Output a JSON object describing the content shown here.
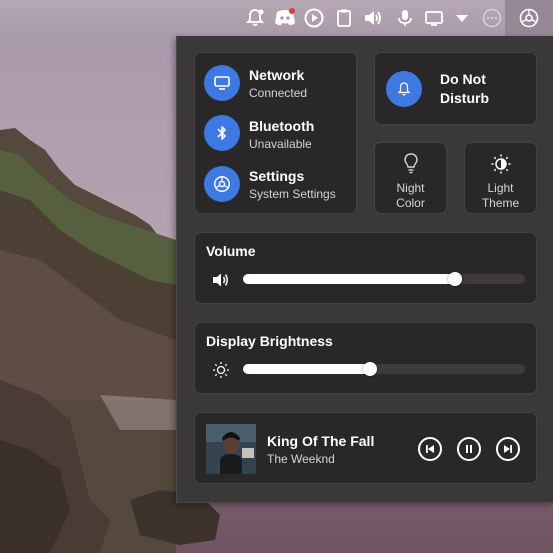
{
  "tray": {
    "icons": [
      "bell-alert-icon",
      "discord-icon",
      "play-icon",
      "clipboard-icon",
      "volume-icon",
      "microphone-icon",
      "display-icon",
      "chevron-down-icon",
      "more-icon",
      "settings-icon"
    ]
  },
  "network": {
    "title": "Network",
    "status": "Connected",
    "icon": "monitor-icon"
  },
  "bluetooth": {
    "title": "Bluetooth",
    "status": "Unavailable",
    "icon": "bluetooth-icon"
  },
  "settings": {
    "title": "Settings",
    "status": "System Settings",
    "icon": "settings-icon"
  },
  "dnd": {
    "label_line1": "Do Not",
    "label_line2": "Disturb",
    "icon": "bell-icon"
  },
  "night_color": {
    "label_line1": "Night",
    "label_line2": "Color",
    "icon": "lightbulb-icon"
  },
  "light_theme": {
    "label_line1": "Light",
    "label_line2": "Theme",
    "icon": "sun-half-icon"
  },
  "volume": {
    "title": "Volume",
    "level": 0.75,
    "icon": "speaker-icon"
  },
  "brightness": {
    "title": "Display Brightness",
    "level": 0.45,
    "icon": "brightness-icon"
  },
  "media": {
    "track": "King Of The Fall",
    "artist": "The Weeknd"
  },
  "colors": {
    "accent": "#3d78e3",
    "panel": "#3b3839",
    "card": "#2a2728"
  }
}
